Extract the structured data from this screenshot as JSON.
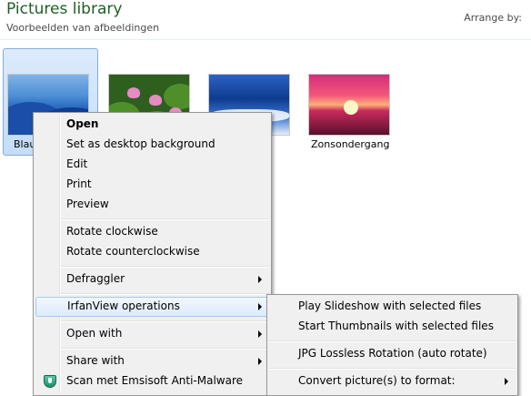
{
  "header": {
    "title": "Pictures library",
    "subtitle": "Voorbeelden van afbeeldingen",
    "arrange_label": "Arrange by:"
  },
  "thumbnails": [
    {
      "caption": "Blau",
      "selected": true
    },
    {
      "caption": "",
      "selected": false
    },
    {
      "caption": "",
      "selected": false
    },
    {
      "caption": "Zonsondergang",
      "selected": false
    }
  ],
  "context_menu": {
    "items": [
      {
        "label": "Open",
        "bold": true
      },
      {
        "label": "Set as desktop background"
      },
      {
        "label": "Edit"
      },
      {
        "label": "Print"
      },
      {
        "label": "Preview"
      },
      {
        "label": "Rotate clockwise"
      },
      {
        "label": "Rotate counterclockwise"
      },
      {
        "label": "Defraggler",
        "submenu": true
      },
      {
        "label": "IrfanView operations",
        "submenu": true,
        "highlighted": true
      },
      {
        "label": "Open with",
        "submenu": true
      },
      {
        "label": "Share with",
        "submenu": true
      },
      {
        "label": "Scan met Emsisoft Anti-Malware",
        "icon": "emsisoft-shield-icon"
      }
    ]
  },
  "submenu": {
    "items": [
      {
        "label": "Play Slideshow with selected files"
      },
      {
        "label": "Start Thumbnails with selected files"
      },
      {
        "label": "JPG Lossless Rotation (auto rotate)"
      },
      {
        "label": "Convert picture(s) to format:",
        "submenu": true
      }
    ]
  },
  "colors": {
    "title": "#1e5f23",
    "menu_background": "#f0f0f0",
    "highlight_border": "#a8c8ee"
  }
}
